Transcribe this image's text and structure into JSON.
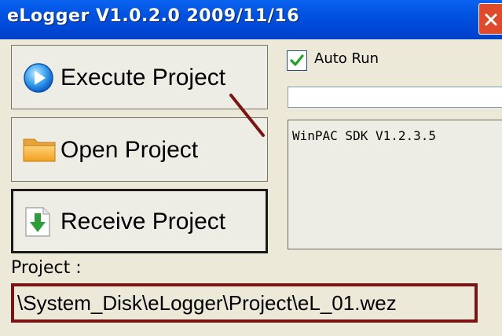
{
  "window": {
    "title": "eLogger V1.0.2.0 2009/11/16"
  },
  "buttons": {
    "execute": {
      "label": "Execute Project",
      "icon": "play-icon"
    },
    "open": {
      "label": "Open Project",
      "icon": "folder-icon"
    },
    "receive": {
      "label": "Receive Project",
      "icon": "download-icon"
    }
  },
  "auto_run": {
    "label": "Auto Run",
    "checked": true
  },
  "info": {
    "text": "WinPAC SDK V1.2.3.5"
  },
  "project": {
    "label": "Project :",
    "path": "\\System_Disk\\eLogger\\Project\\eL_01.wez"
  },
  "colors": {
    "titlebar": "#0151E0",
    "close": "#E04A2A",
    "highlight": "#7B1414",
    "window_bg": "#ECE9D8"
  }
}
